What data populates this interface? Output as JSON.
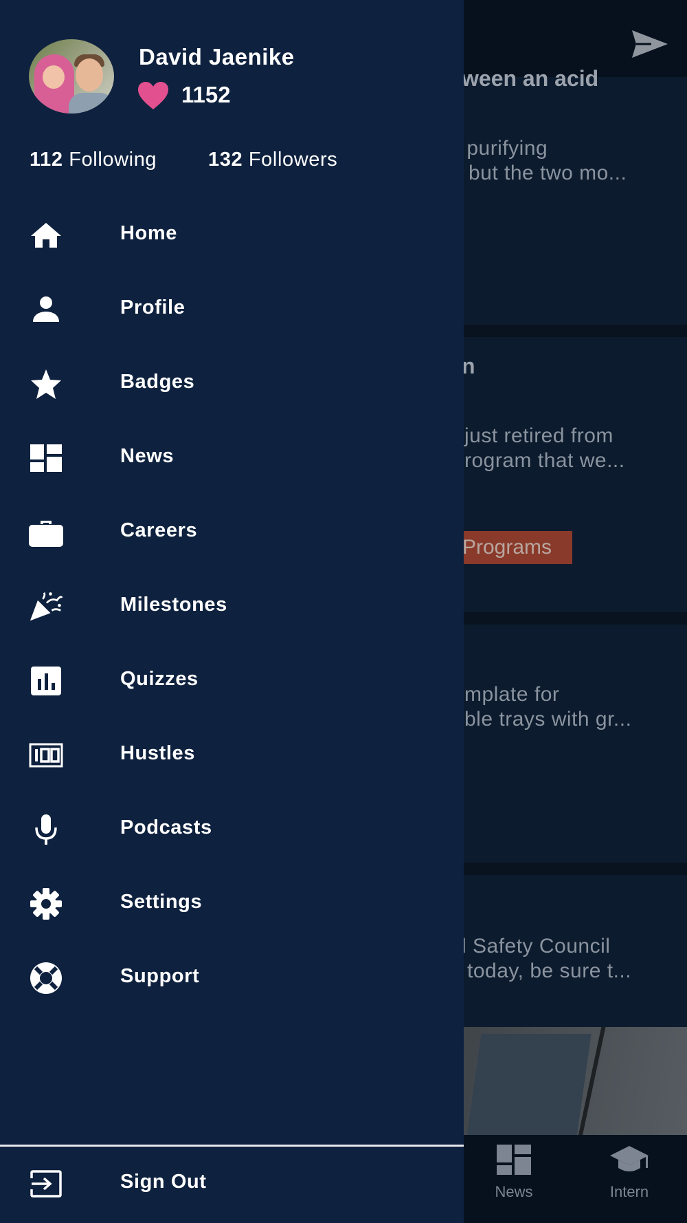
{
  "background": {
    "texts": {
      "card1_title": "ween an acid",
      "card1_line1": "r purifying",
      "card1_line2": "but the two mo...",
      "card2_title": "n",
      "card2_line1": "just retired from",
      "card2_line2": "rogram that we...",
      "card2_tag": "Programs",
      "card3_line1": "mplate for",
      "card3_line2": "ble trays with gr...",
      "card4_line1": "l Safety Council",
      "card4_line2": "today, be sure t..."
    },
    "bottom_nav": [
      {
        "label": "News",
        "icon": "dashboard-icon"
      },
      {
        "label": "Intern",
        "icon": "graduation-cap-icon"
      }
    ],
    "send_icon": "send-icon"
  },
  "profile": {
    "name": "David Jaenike",
    "hearts": "1152",
    "following_count": "112",
    "following_label": "Following",
    "followers_count": "132",
    "followers_label": "Followers"
  },
  "menu": [
    {
      "label": "Home",
      "icon": "home-icon"
    },
    {
      "label": "Profile",
      "icon": "person-icon"
    },
    {
      "label": "Badges",
      "icon": "star-icon"
    },
    {
      "label": "News",
      "icon": "dashboard-icon"
    },
    {
      "label": "Careers",
      "icon": "briefcase-icon"
    },
    {
      "label": "Milestones",
      "icon": "party-popper-icon"
    },
    {
      "label": "Quizzes",
      "icon": "bar-chart-icon"
    },
    {
      "label": "Hustles",
      "icon": "counter-100-icon"
    },
    {
      "label": "Podcasts",
      "icon": "microphone-icon"
    },
    {
      "label": "Settings",
      "icon": "gear-icon"
    },
    {
      "label": "Support",
      "icon": "lifebuoy-icon"
    }
  ],
  "signout": {
    "label": "Sign Out",
    "icon": "exit-icon"
  },
  "colors": {
    "drawer_bg": "#0e213e",
    "heart": "#e2508f",
    "text": "#ffffff"
  }
}
